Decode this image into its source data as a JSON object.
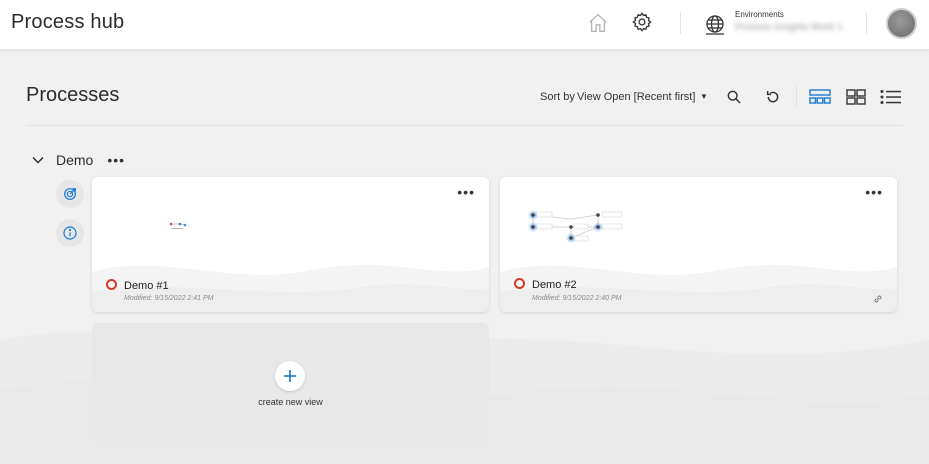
{
  "app": {
    "title": "Process hub"
  },
  "header": {
    "environment_label": "Environments",
    "environment_value": "Process Insights Work 1"
  },
  "page": {
    "title": "Processes"
  },
  "toolbar": {
    "sort_label": "Sort by",
    "sort_value": "View Open [Recent first]",
    "accent_color": "#1a7ad4"
  },
  "group": {
    "name": "Demo",
    "cards": [
      {
        "title": "Demo #1",
        "modified": "Modified: 9/15/2022 2:41 PM"
      },
      {
        "title": "Demo #2",
        "modified": "Modified: 9/15/2022 2:40 PM"
      }
    ],
    "new_view_label": "create new view"
  },
  "icons": {
    "header": [
      "home-icon",
      "settings-icon",
      "globe-icon",
      "avatar"
    ],
    "toolbar": [
      "search-icon",
      "refresh-icon",
      "card-view-icon",
      "grid-view-icon",
      "list-view-icon"
    ],
    "group": [
      "chevron-down-icon",
      "target-icon",
      "info-icon",
      "more-icon",
      "link-icon",
      "plus-icon"
    ]
  },
  "colors": {
    "status_ring": "#d33a2c",
    "active_view": "#1a7ad4",
    "flow_node_glow": "#3b8fe0"
  }
}
